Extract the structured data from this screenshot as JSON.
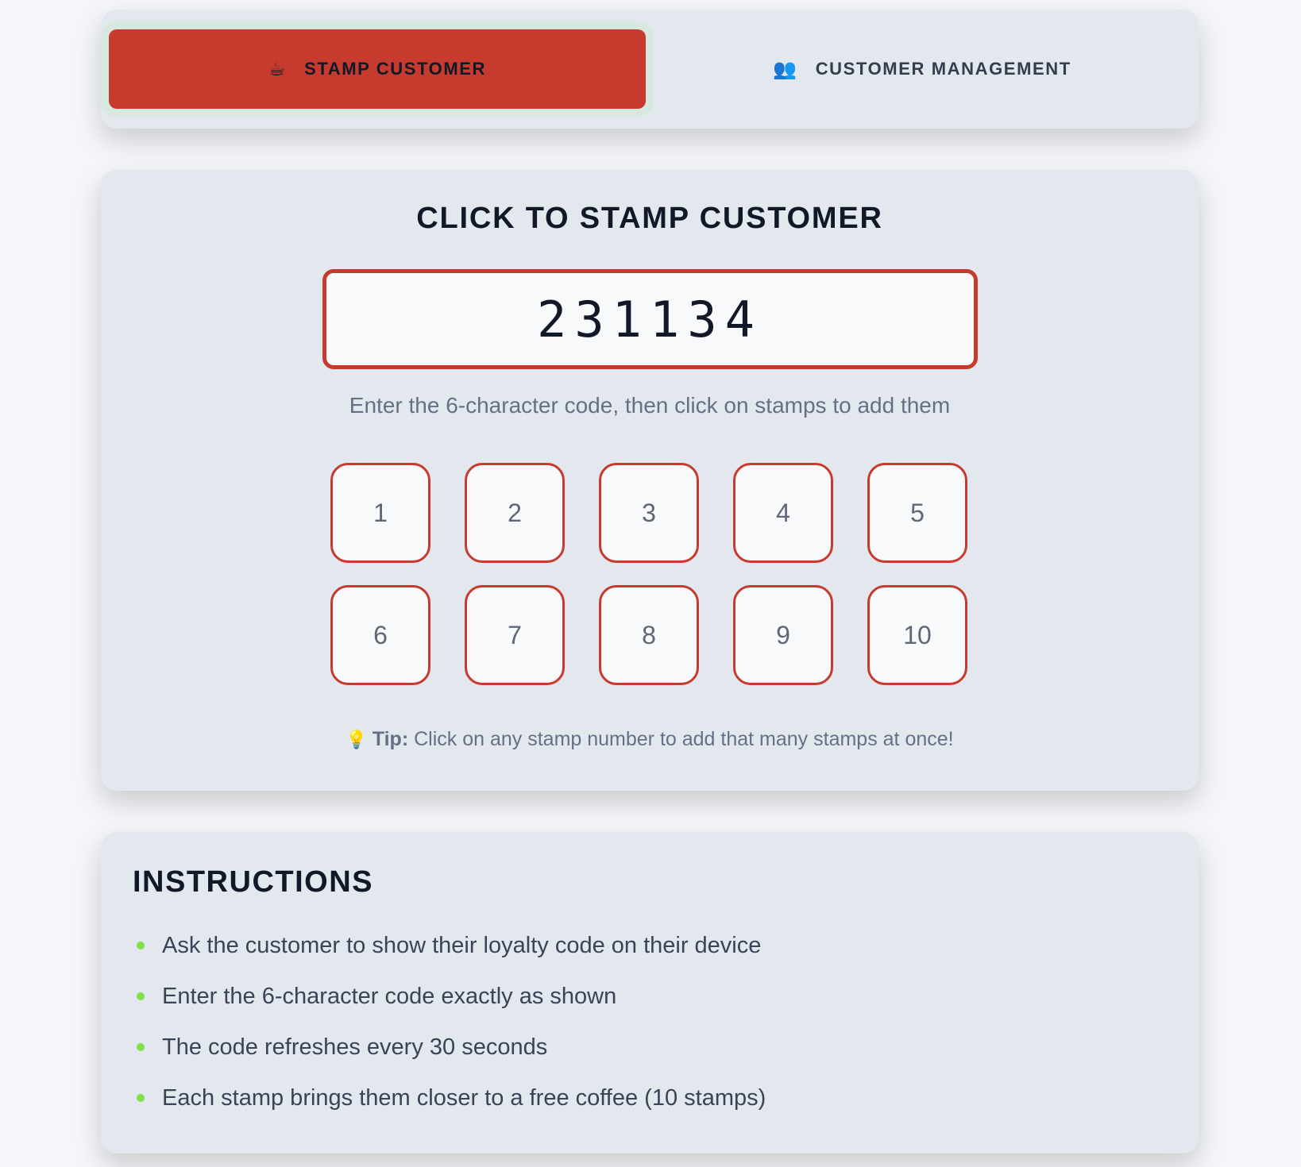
{
  "tabs": [
    {
      "icon": "☕",
      "label": "STAMP CUSTOMER",
      "active": true
    },
    {
      "icon": "👥",
      "label": "CUSTOMER MANAGEMENT",
      "active": false
    }
  ],
  "stamp_section": {
    "title": "CLICK TO STAMP CUSTOMER",
    "code_value": "231134",
    "hint": "Enter the 6-character code, then click on stamps to add them",
    "stamps": [
      "1",
      "2",
      "3",
      "4",
      "5",
      "6",
      "7",
      "8",
      "9",
      "10"
    ],
    "tip_icon": "💡",
    "tip_label": "Tip:",
    "tip_text": " Click on any stamp number to add that many stamps at once!"
  },
  "instructions": {
    "title": "INSTRUCTIONS",
    "items": [
      "Ask the customer to show their loyalty code on their device",
      "Enter the 6-character code exactly as shown",
      "The code refreshes every 30 seconds",
      "Each stamp brings them closer to a free coffee (10 stamps)"
    ]
  },
  "colors": {
    "accent": "#c63b2e",
    "card_bg": "#e3e8ef",
    "bullet": "#7ee04a"
  }
}
